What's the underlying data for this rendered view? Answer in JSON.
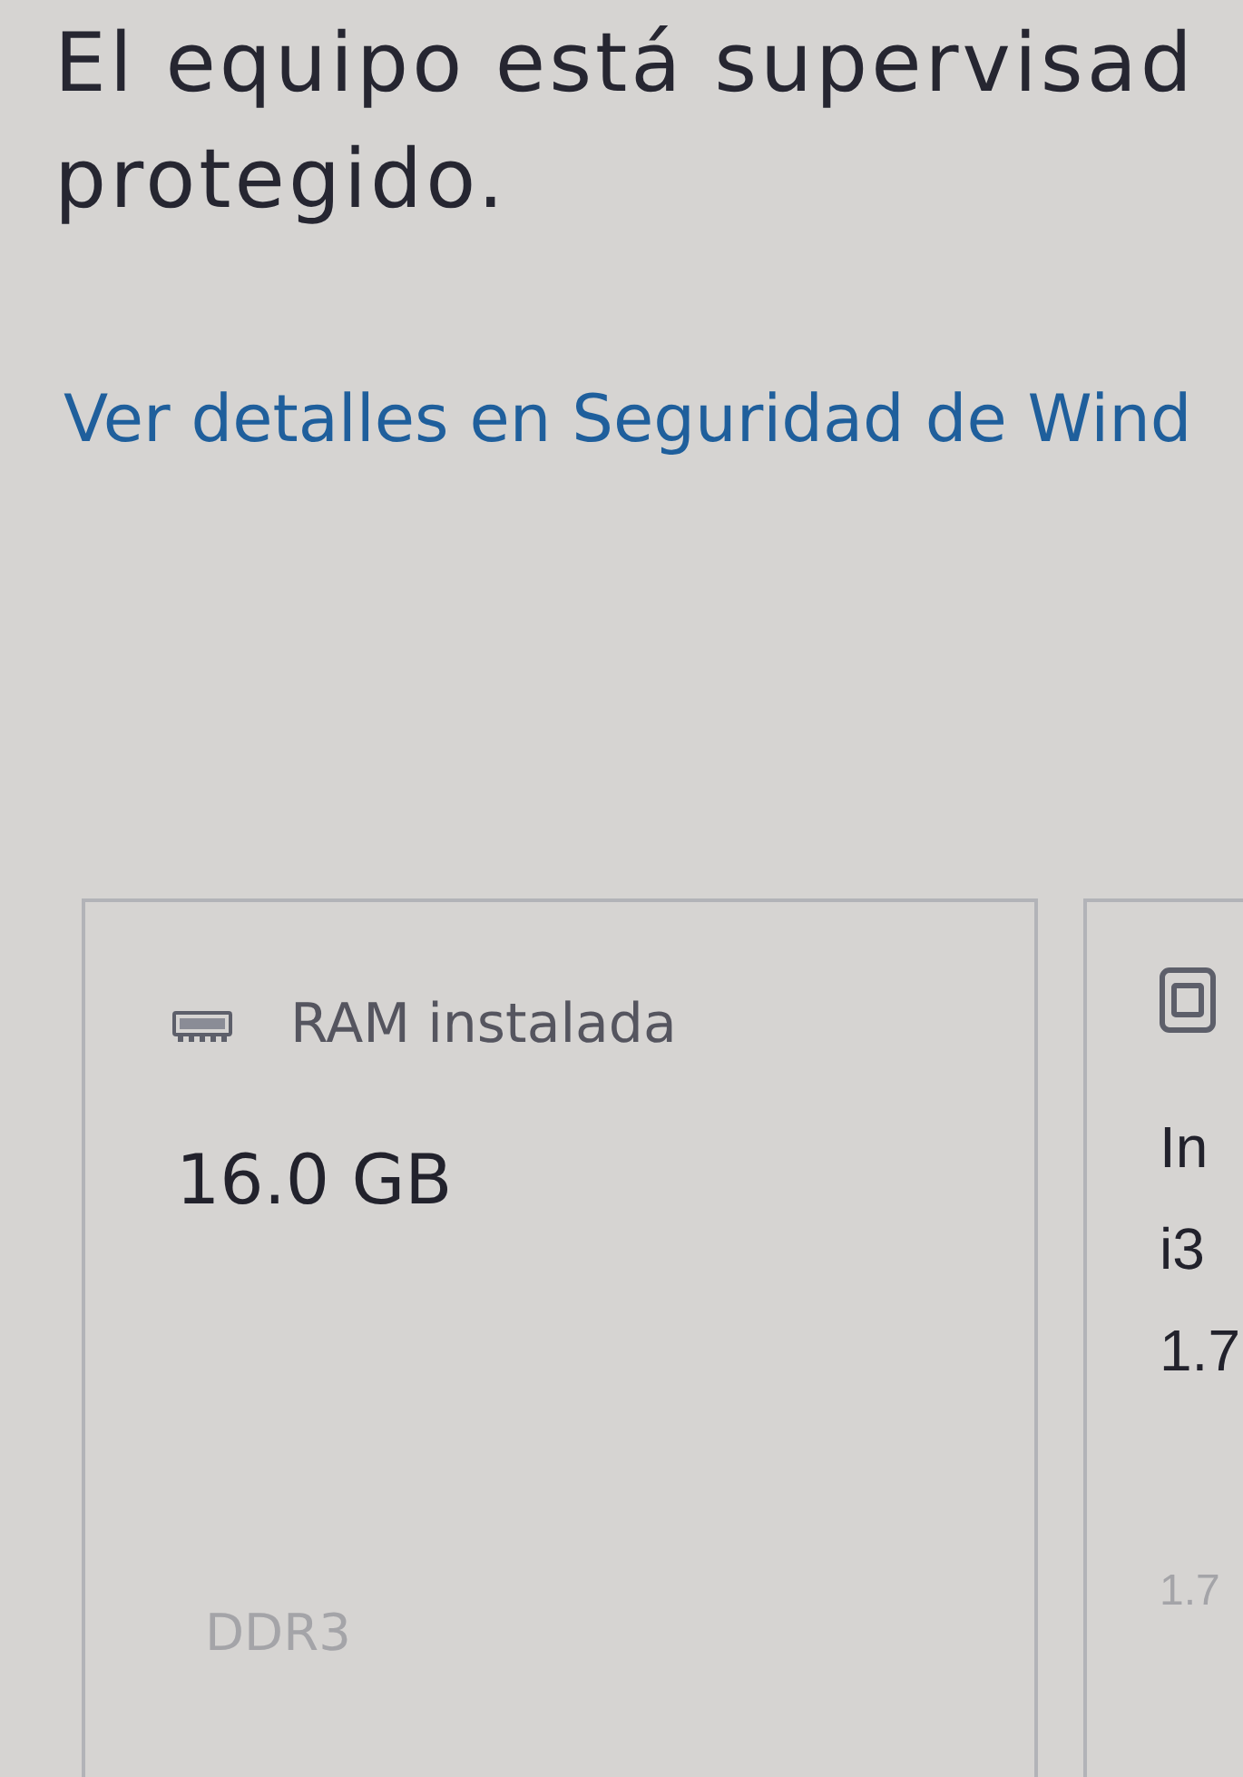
{
  "status_message": {
    "lines": [
      "El equipo está supervisad",
      "protegido."
    ]
  },
  "details_link": "Ver detalles en Seguridad de Wind",
  "cards": [
    {
      "kind": "memory",
      "label": "RAM instalada",
      "value_lines": [
        "16.0 GB"
      ],
      "detail": "DDR3"
    },
    {
      "kind": "processor",
      "value_lines": [
        "In",
        "i3",
        "1.7"
      ],
      "detail": "1.7"
    }
  ]
}
